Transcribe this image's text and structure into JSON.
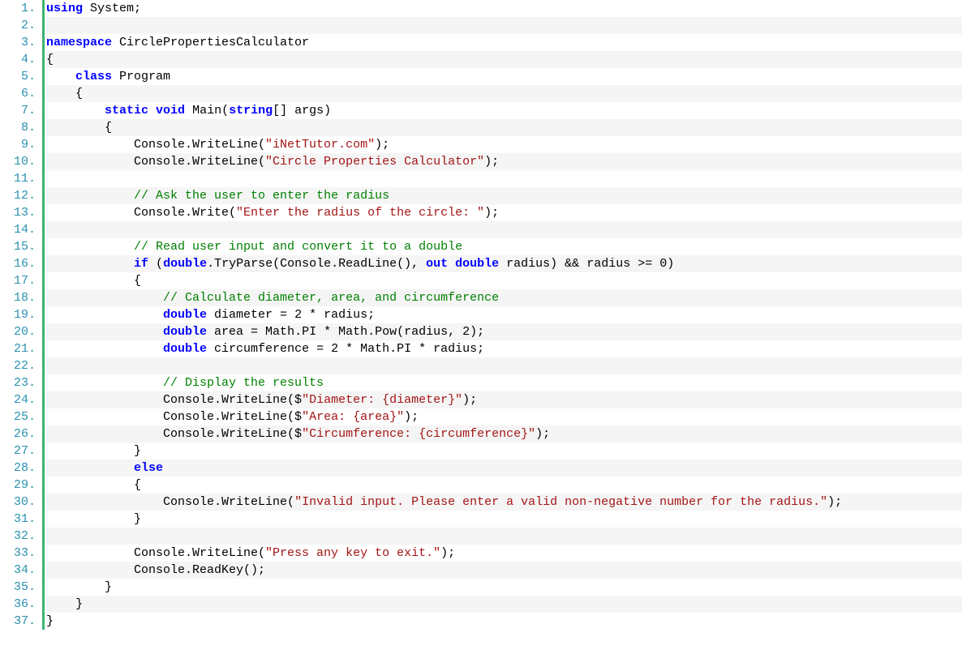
{
  "lineCount": 37,
  "code": {
    "lines": [
      [
        {
          "t": "kw",
          "v": "using"
        },
        {
          "t": "txt",
          "v": " System;"
        }
      ],
      [],
      [
        {
          "t": "kw",
          "v": "namespace"
        },
        {
          "t": "txt",
          "v": " CirclePropertiesCalculator"
        }
      ],
      [
        {
          "t": "txt",
          "v": "{"
        }
      ],
      [
        {
          "t": "txt",
          "v": "    "
        },
        {
          "t": "kw",
          "v": "class"
        },
        {
          "t": "txt",
          "v": " Program"
        }
      ],
      [
        {
          "t": "txt",
          "v": "    {"
        }
      ],
      [
        {
          "t": "txt",
          "v": "        "
        },
        {
          "t": "kw",
          "v": "static"
        },
        {
          "t": "txt",
          "v": " "
        },
        {
          "t": "kw",
          "v": "void"
        },
        {
          "t": "txt",
          "v": " Main("
        },
        {
          "t": "kw",
          "v": "string"
        },
        {
          "t": "txt",
          "v": "[] args)"
        }
      ],
      [
        {
          "t": "txt",
          "v": "        {"
        }
      ],
      [
        {
          "t": "txt",
          "v": "            Console.WriteLine("
        },
        {
          "t": "str",
          "v": "\"iNetTutor.com\""
        },
        {
          "t": "txt",
          "v": ");"
        }
      ],
      [
        {
          "t": "txt",
          "v": "            Console.WriteLine("
        },
        {
          "t": "str",
          "v": "\"Circle Properties Calculator\""
        },
        {
          "t": "txt",
          "v": ");"
        }
      ],
      [],
      [
        {
          "t": "txt",
          "v": "            "
        },
        {
          "t": "com",
          "v": "// Ask the user to enter the radius"
        }
      ],
      [
        {
          "t": "txt",
          "v": "            Console.Write("
        },
        {
          "t": "str",
          "v": "\"Enter the radius of the circle: \""
        },
        {
          "t": "txt",
          "v": ");"
        }
      ],
      [],
      [
        {
          "t": "txt",
          "v": "            "
        },
        {
          "t": "com",
          "v": "// Read user input and convert it to a double"
        }
      ],
      [
        {
          "t": "txt",
          "v": "            "
        },
        {
          "t": "kw",
          "v": "if"
        },
        {
          "t": "txt",
          "v": " ("
        },
        {
          "t": "kw",
          "v": "double"
        },
        {
          "t": "txt",
          "v": ".TryParse(Console.ReadLine(), "
        },
        {
          "t": "kw",
          "v": "out"
        },
        {
          "t": "txt",
          "v": " "
        },
        {
          "t": "kw",
          "v": "double"
        },
        {
          "t": "txt",
          "v": " radius) && radius >= 0)"
        }
      ],
      [
        {
          "t": "txt",
          "v": "            {"
        }
      ],
      [
        {
          "t": "txt",
          "v": "                "
        },
        {
          "t": "com",
          "v": "// Calculate diameter, area, and circumference"
        }
      ],
      [
        {
          "t": "txt",
          "v": "                "
        },
        {
          "t": "kw",
          "v": "double"
        },
        {
          "t": "txt",
          "v": " diameter = 2 * radius;"
        }
      ],
      [
        {
          "t": "txt",
          "v": "                "
        },
        {
          "t": "kw",
          "v": "double"
        },
        {
          "t": "txt",
          "v": " area = Math.PI * Math.Pow(radius, 2);"
        }
      ],
      [
        {
          "t": "txt",
          "v": "                "
        },
        {
          "t": "kw",
          "v": "double"
        },
        {
          "t": "txt",
          "v": " circumference = 2 * Math.PI * radius;"
        }
      ],
      [],
      [
        {
          "t": "txt",
          "v": "                "
        },
        {
          "t": "com",
          "v": "// Display the results"
        }
      ],
      [
        {
          "t": "txt",
          "v": "                Console.WriteLine($"
        },
        {
          "t": "str",
          "v": "\"Diameter: {diameter}\""
        },
        {
          "t": "txt",
          "v": ");"
        }
      ],
      [
        {
          "t": "txt",
          "v": "                Console.WriteLine($"
        },
        {
          "t": "str",
          "v": "\"Area: {area}\""
        },
        {
          "t": "txt",
          "v": ");"
        }
      ],
      [
        {
          "t": "txt",
          "v": "                Console.WriteLine($"
        },
        {
          "t": "str",
          "v": "\"Circumference: {circumference}\""
        },
        {
          "t": "txt",
          "v": ");"
        }
      ],
      [
        {
          "t": "txt",
          "v": "            }"
        }
      ],
      [
        {
          "t": "txt",
          "v": "            "
        },
        {
          "t": "kw",
          "v": "else"
        }
      ],
      [
        {
          "t": "txt",
          "v": "            {"
        }
      ],
      [
        {
          "t": "txt",
          "v": "                Console.WriteLine("
        },
        {
          "t": "str",
          "v": "\"Invalid input. Please enter a valid non-negative number for the radius.\""
        },
        {
          "t": "txt",
          "v": ");"
        }
      ],
      [
        {
          "t": "txt",
          "v": "            }"
        }
      ],
      [],
      [
        {
          "t": "txt",
          "v": "            Console.WriteLine("
        },
        {
          "t": "str",
          "v": "\"Press any key to exit.\""
        },
        {
          "t": "txt",
          "v": ");"
        }
      ],
      [
        {
          "t": "txt",
          "v": "            Console.ReadKey();"
        }
      ],
      [
        {
          "t": "txt",
          "v": "        }"
        }
      ],
      [
        {
          "t": "txt",
          "v": "    }"
        }
      ],
      [
        {
          "t": "txt",
          "v": "}"
        }
      ]
    ]
  }
}
